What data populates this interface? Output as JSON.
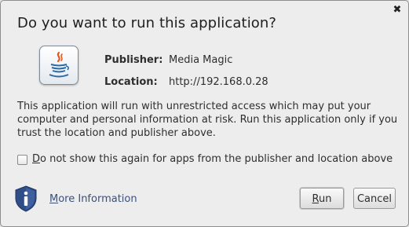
{
  "dialog": {
    "title": "Do you want to run this application?",
    "close_icon": "close-icon",
    "app_icon": "java-logo-icon",
    "publisher_label": "Publisher:",
    "publisher_value": "Media Magic",
    "location_label": "Location:",
    "location_value": "http://192.168.0.28",
    "message": "This application will run with unrestricted access which may put your computer and personal information at risk. Run this application only if you trust the location and publisher above.",
    "checkbox": {
      "checked": false,
      "mnemonic": "D",
      "label_rest": "o not show this again for apps from the publisher and location above"
    },
    "shield_icon": "shield-info-icon",
    "more_info": {
      "mnemonic": "M",
      "rest": "ore Information"
    },
    "buttons": {
      "run": {
        "mnemonic": "R",
        "rest": "un"
      },
      "cancel": "Cancel"
    }
  },
  "colors": {
    "dialog_bg": "#ededed",
    "link": "#3b5078",
    "shield": "#2f4d87"
  }
}
